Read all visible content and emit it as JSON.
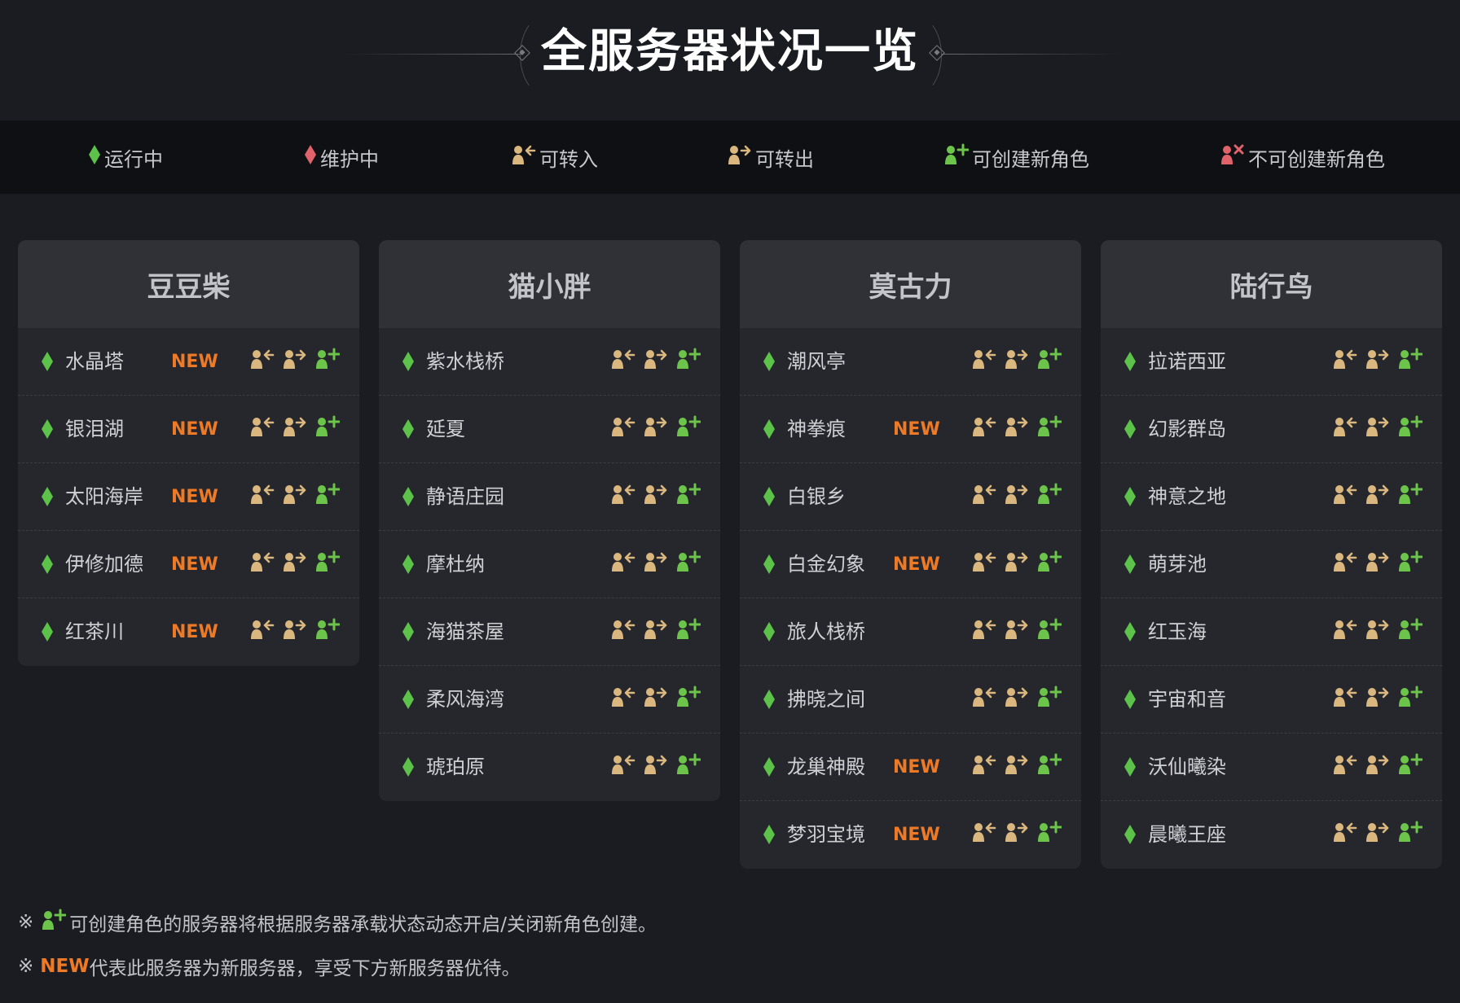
{
  "page": {
    "title": "全服务器状况一览"
  },
  "legend": {
    "running": "运行中",
    "maintenance": "维护中",
    "transfer_in": "可转入",
    "transfer_out": "可转出",
    "create_char": "可创建新角色",
    "no_create_char": "不可创建新角色"
  },
  "colors": {
    "running": "#5cc24a",
    "maintenance": "#e0626a",
    "transfer_icon": "#d9b77e",
    "create_icon": "#6cc44a",
    "no_create_icon": "#e0626a",
    "new_badge": "#ef7a26"
  },
  "icons": {
    "status": "diamond-icon",
    "transfer_in": "user-transfer-in-icon",
    "transfer_out": "user-transfer-out-icon",
    "create": "user-add-icon",
    "no_create": "user-block-icon"
  },
  "new_label": "NEW",
  "regions": [
    {
      "name": "豆豆柴",
      "servers": [
        {
          "name": "水晶塔",
          "new": true
        },
        {
          "name": "银泪湖",
          "new": true
        },
        {
          "name": "太阳海岸",
          "new": true
        },
        {
          "name": "伊修加德",
          "new": true
        },
        {
          "name": "红茶川",
          "new": true
        }
      ]
    },
    {
      "name": "猫小胖",
      "servers": [
        {
          "name": "紫水栈桥",
          "new": false
        },
        {
          "name": "延夏",
          "new": false
        },
        {
          "name": "静语庄园",
          "new": false
        },
        {
          "name": "摩杜纳",
          "new": false
        },
        {
          "name": "海猫茶屋",
          "new": false
        },
        {
          "name": "柔风海湾",
          "new": false
        },
        {
          "name": "琥珀原",
          "new": false
        }
      ]
    },
    {
      "name": "莫古力",
      "servers": [
        {
          "name": "潮风亭",
          "new": false
        },
        {
          "name": "神拳痕",
          "new": true
        },
        {
          "name": "白银乡",
          "new": false
        },
        {
          "name": "白金幻象",
          "new": true
        },
        {
          "name": "旅人栈桥",
          "new": false
        },
        {
          "name": "拂晓之间",
          "new": false
        },
        {
          "name": "龙巢神殿",
          "new": true
        },
        {
          "name": "梦羽宝境",
          "new": true
        }
      ]
    },
    {
      "name": "陆行鸟",
      "servers": [
        {
          "name": "拉诺西亚",
          "new": false
        },
        {
          "name": "幻影群岛",
          "new": false
        },
        {
          "name": "神意之地",
          "new": false
        },
        {
          "name": "萌芽池",
          "new": false
        },
        {
          "name": "红玉海",
          "new": false
        },
        {
          "name": "宇宙和音",
          "new": false
        },
        {
          "name": "沃仙曦染",
          "new": false
        },
        {
          "name": "晨曦王座",
          "new": false
        }
      ]
    }
  ],
  "notes": {
    "mark": "※",
    "note1": "可创建角色的服务器将根据服务器承载状态动态开启/关闭新角色创建。",
    "note2_new": "NEW",
    "note2_rest": "代表此服务器为新服务器，享受下方新服务器优待。"
  }
}
